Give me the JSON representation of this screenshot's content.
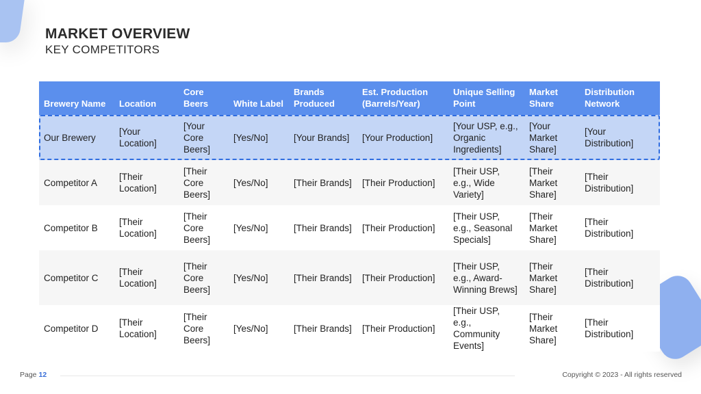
{
  "header": {
    "title": "MARKET OVERVIEW",
    "subtitle": "KEY COMPETITORS"
  },
  "table": {
    "columns": [
      "Brewery Name",
      "Location",
      "Core Beers",
      "White Label",
      "Brands Produced",
      "Est. Production (Barrels/Year)",
      "Unique Selling Point",
      "Market Share",
      "Distribution Network"
    ],
    "rows": [
      [
        "Our Brewery",
        "[Your Location]",
        "[Your Core Beers]",
        "[Yes/No]",
        "[Your Brands]",
        "[Your Production]",
        "[Your USP, e.g., Organic Ingredients]",
        "[Your Market Share]",
        "[Your Distribution]"
      ],
      [
        "Competitor A",
        "[Their Location]",
        "[Their Core Beers]",
        "[Yes/No]",
        "[Their Brands]",
        "[Their Production]",
        "[Their USP, e.g., Wide Variety]",
        "[Their Market Share]",
        "[Their Distribution]"
      ],
      [
        "Competitor B",
        "[Their Location]",
        "[Their Core Beers]",
        "[Yes/No]",
        "[Their Brands]",
        "[Their Production]",
        "[Their USP, e.g., Seasonal Specials]",
        "[Their Market Share]",
        "[Their Distribution]"
      ],
      [
        "Competitor C",
        "[Their Location]",
        "[Their Core Beers]",
        "[Yes/No]",
        "[Their Brands]",
        "[Their Production]",
        "[Their USP, e.g., Award-Winning Brews]",
        "[Their Market Share]",
        "[Their Distribution]"
      ],
      [
        "Competitor D",
        "[Their Location]",
        "[Their Core Beers]",
        "[Yes/No]",
        "[Their Brands]",
        "[Their Production]",
        "[Their USP, e.g., Community Events]",
        "[Their Market Share]",
        "[Their Distribution]"
      ]
    ]
  },
  "footer": {
    "page_label": "Page",
    "page_number": "12",
    "copyright": "Copyright © 2023 - All rights reserved"
  },
  "colors": {
    "header_bg": "#5b8fed",
    "highlight_row_bg": "#c4d6f6",
    "highlight_border": "#2f6de0",
    "accent": "#3a6fd8"
  }
}
